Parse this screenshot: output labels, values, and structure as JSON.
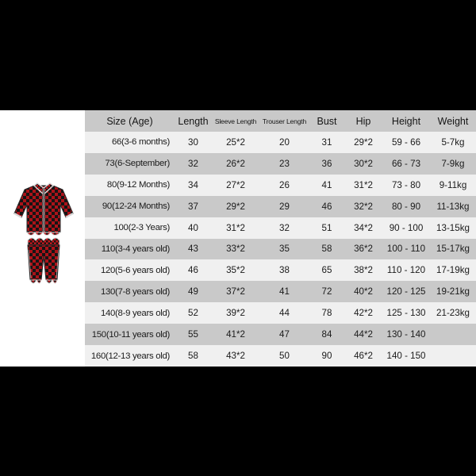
{
  "background_color": "#000000",
  "chart": {
    "band_background": "#f0f0f0",
    "header_background": "#c9c9c9",
    "row_odd_background": "#f0f0f0",
    "row_even_background": "#c9c9c9",
    "product_panel_background": "#ffffff"
  },
  "product_image": {
    "icon_name": "plaid-pajama-set",
    "description": "Red and black buffalo plaid two-piece pajama set with ruffled trim",
    "colors": {
      "plaid_red": "#c4161c",
      "plaid_dark": "#151515",
      "plaid_blend": "#7a0f13",
      "trim": "#d8d8d8"
    }
  },
  "table": {
    "columns": [
      {
        "label": "Size (Age)",
        "name": "size-age",
        "size": "large"
      },
      {
        "label": "Length",
        "name": "length",
        "size": "large"
      },
      {
        "label": "Sleeve Length",
        "name": "sleeve-length",
        "size": "small"
      },
      {
        "label": "Trouser Length",
        "name": "trouser-length",
        "size": "small"
      },
      {
        "label": "Bust",
        "name": "bust",
        "size": "large"
      },
      {
        "label": "Hip",
        "name": "hip",
        "size": "large"
      },
      {
        "label": "Height",
        "name": "height",
        "size": "large"
      },
      {
        "label": "Weight",
        "name": "weight",
        "size": "large"
      }
    ],
    "rows": [
      {
        "size_age": "66(3-6 months)",
        "length": "30",
        "sleeve_length": "25*2",
        "trouser_length": "20",
        "bust": "31",
        "hip": "29*2",
        "height": "59 - 66",
        "weight": "5-7kg"
      },
      {
        "size_age": "73(6-September)",
        "length": "32",
        "sleeve_length": "26*2",
        "trouser_length": "23",
        "bust": "36",
        "hip": "30*2",
        "height": "66 - 73",
        "weight": "7-9kg"
      },
      {
        "size_age": "80(9-12 Months)",
        "length": "34",
        "sleeve_length": "27*2",
        "trouser_length": "26",
        "bust": "41",
        "hip": "31*2",
        "height": "73 - 80",
        "weight": "9-11kg"
      },
      {
        "size_age": "90(12-24 Months)",
        "length": "37",
        "sleeve_length": "29*2",
        "trouser_length": "29",
        "bust": "46",
        "hip": "32*2",
        "height": "80 - 90",
        "weight": "11-13kg"
      },
      {
        "size_age": "100(2-3 Years)",
        "length": "40",
        "sleeve_length": "31*2",
        "trouser_length": "32",
        "bust": "51",
        "hip": "34*2",
        "height": "90 - 100",
        "weight": "13-15kg"
      },
      {
        "size_age": "110(3-4 years old)",
        "length": "43",
        "sleeve_length": "33*2",
        "trouser_length": "35",
        "bust": "58",
        "hip": "36*2",
        "height": "100 - 110",
        "weight": "15-17kg"
      },
      {
        "size_age": "120(5-6 years old)",
        "length": "46",
        "sleeve_length": "35*2",
        "trouser_length": "38",
        "bust": "65",
        "hip": "38*2",
        "height": "110 - 120",
        "weight": "17-19kg"
      },
      {
        "size_age": "130(7-8 years old)",
        "length": "49",
        "sleeve_length": "37*2",
        "trouser_length": "41",
        "bust": "72",
        "hip": "40*2",
        "height": "120 - 125",
        "weight": "19-21kg"
      },
      {
        "size_age": "140(8-9 years old)",
        "length": "52",
        "sleeve_length": "39*2",
        "trouser_length": "44",
        "bust": "78",
        "hip": "42*2",
        "height": "125 - 130",
        "weight": "21-23kg"
      },
      {
        "size_age": "150(10-11 years old)",
        "length": "55",
        "sleeve_length": "41*2",
        "trouser_length": "47",
        "bust": "84",
        "hip": "44*2",
        "height": "130 - 140",
        "weight": ""
      },
      {
        "size_age": "160(12-13 years old)",
        "length": "58",
        "sleeve_length": "43*2",
        "trouser_length": "50",
        "bust": "90",
        "hip": "46*2",
        "height": "140 - 150",
        "weight": ""
      }
    ]
  }
}
